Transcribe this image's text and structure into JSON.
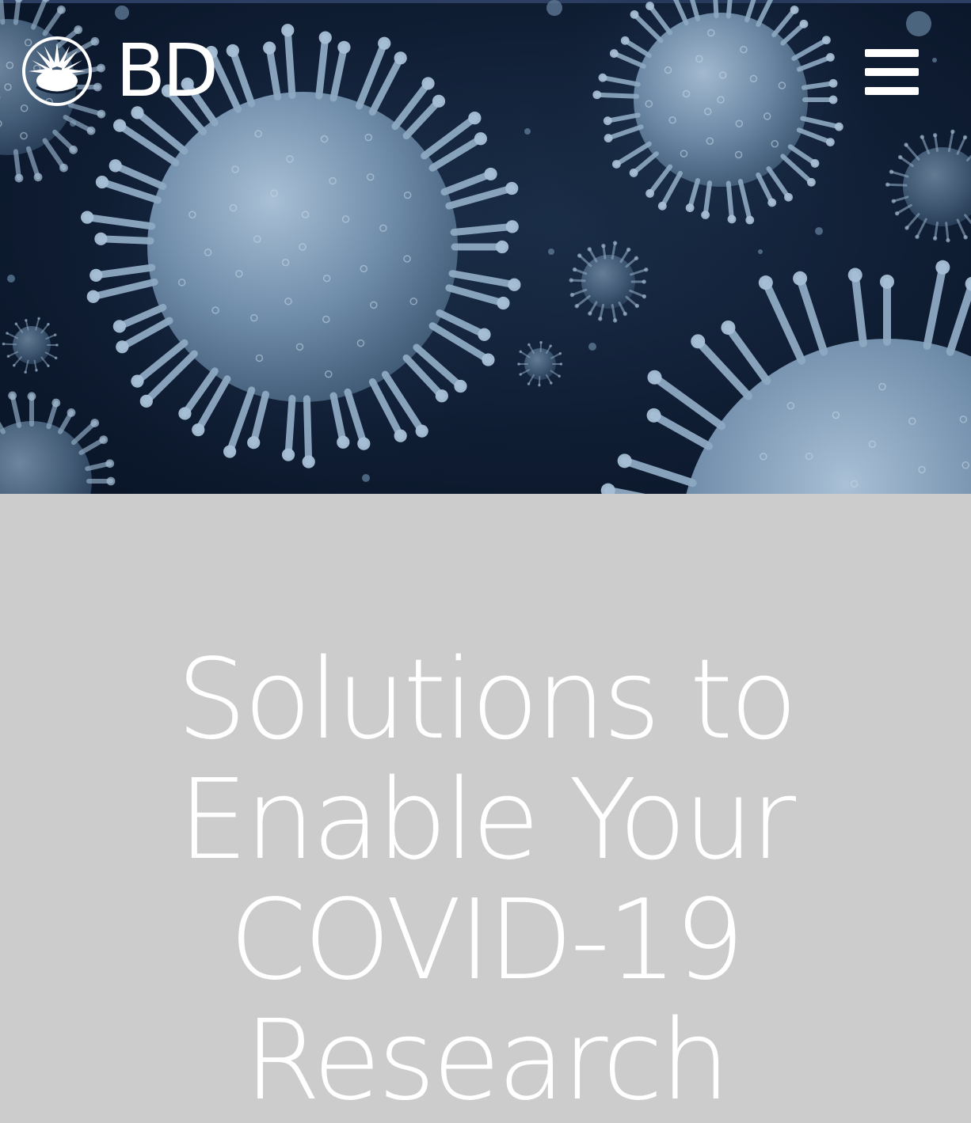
{
  "header": {
    "logo_text": "BD",
    "menu_icon": "hamburger-menu-icon",
    "hero_image": "coronavirus-particles"
  },
  "main": {
    "headline_lines": [
      "Solutions to",
      "Enable Your",
      "COVID-19",
      "Research"
    ]
  },
  "colors": {
    "hero_background": "#0f1d33",
    "virus": "#7f9bb6",
    "content_background": "#cccccc",
    "text": "#ffffff"
  }
}
